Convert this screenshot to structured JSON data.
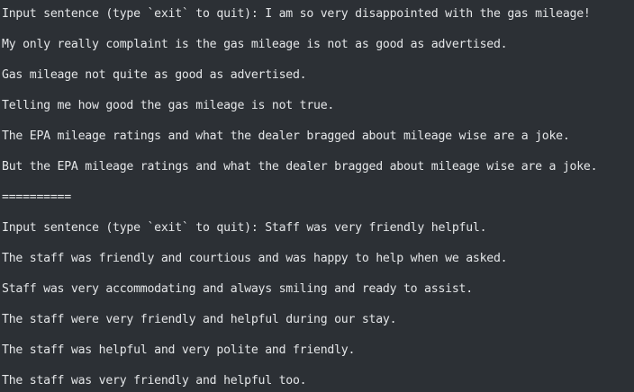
{
  "terminal": {
    "lines": [
      "Input sentence (type `exit` to quit): I am so very disappointed with the gas mileage!",
      "My only really complaint is the gas mileage is not as good as advertised.",
      "Gas mileage not quite as good as advertised.",
      "Telling me how good the gas mileage is not true.",
      "The EPA mileage ratings and what the dealer bragged about mileage wise are a joke.",
      "But the EPA mileage ratings and what the dealer bragged about mileage wise are a joke.",
      "==========",
      "Input sentence (type `exit` to quit): Staff was very friendly helpful.",
      "The staff was friendly and courtious and was happy to help when we asked.",
      "Staff was very accommodating and always smiling and ready to assist.",
      "The staff were very friendly and helpful during our stay.",
      "The staff was helpful and very polite and friendly.",
      "The staff was very friendly and helpful too."
    ]
  }
}
